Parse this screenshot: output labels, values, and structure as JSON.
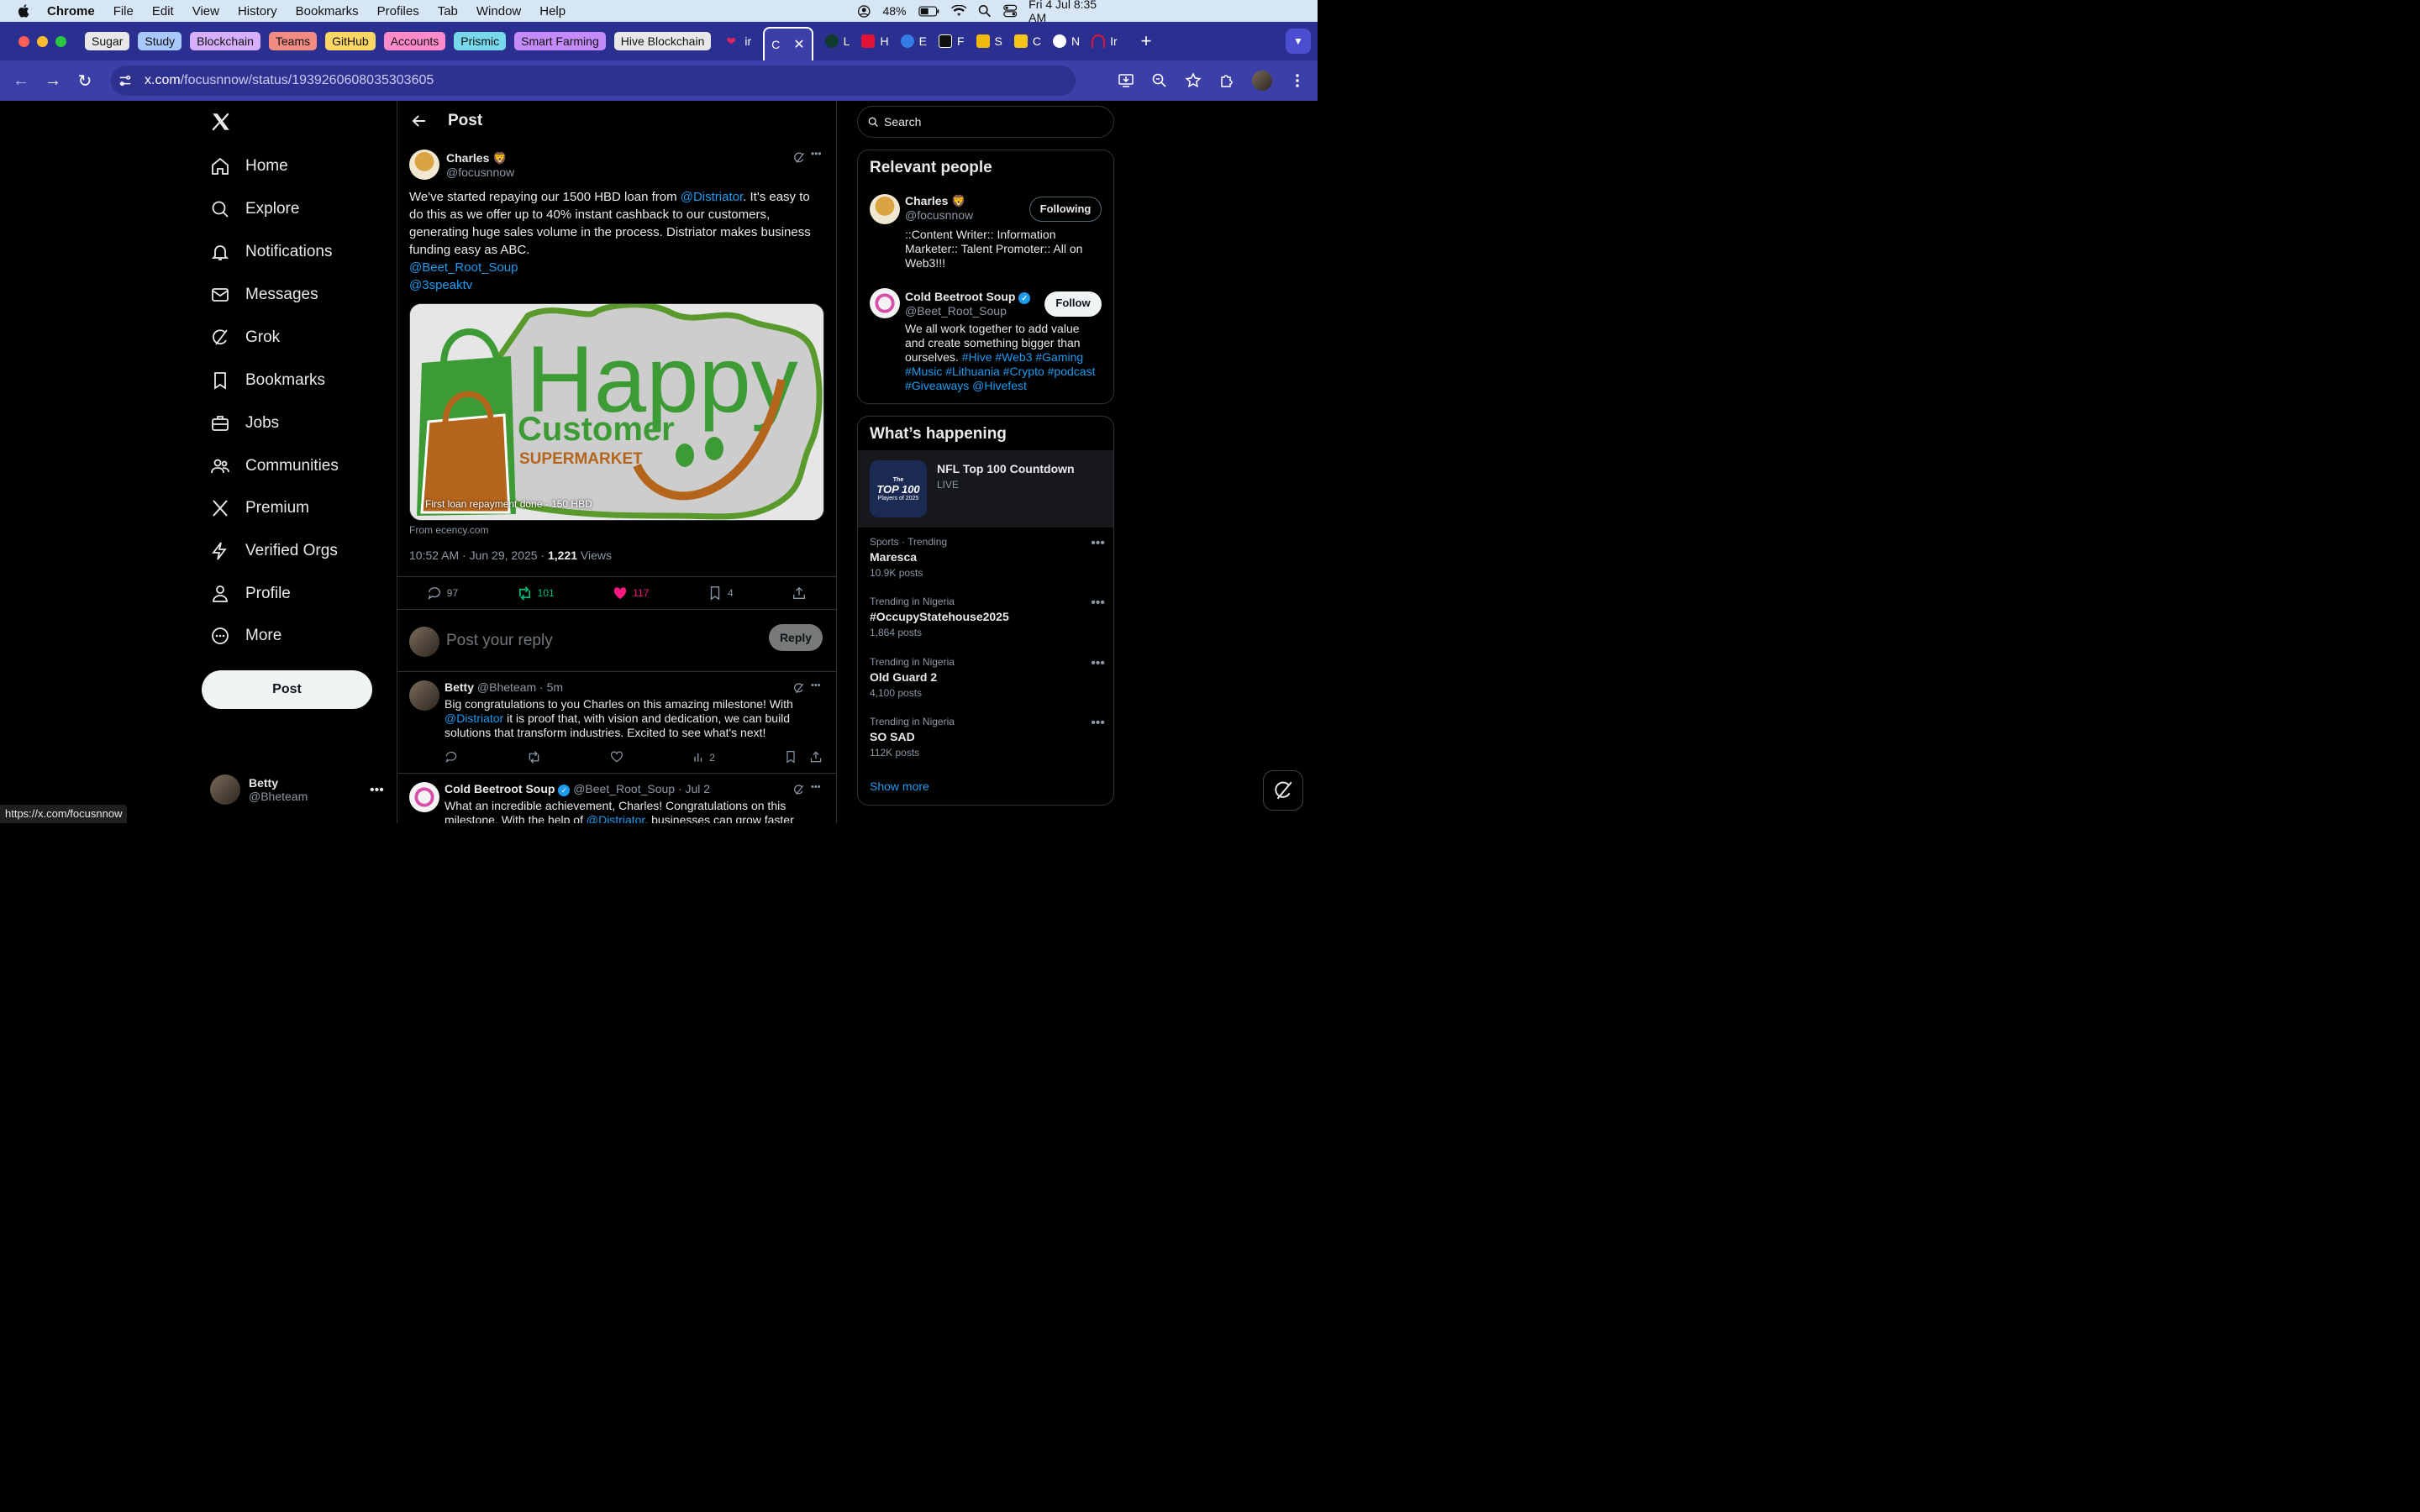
{
  "menubar": {
    "app": "Chrome",
    "items": [
      "File",
      "Edit",
      "View",
      "History",
      "Bookmarks",
      "Profiles",
      "Tab",
      "Window",
      "Help"
    ],
    "battery": "48%",
    "datetime": "Fri 4 Jul  8:35 AM"
  },
  "tabs": {
    "groups": [
      {
        "label": "Sugar",
        "color": "#e8e8e8"
      },
      {
        "label": "Study",
        "color": "#a8c7fa"
      },
      {
        "label": "Blockchain",
        "color": "#d7aefb"
      },
      {
        "label": "Teams",
        "color": "#f28b82"
      },
      {
        "label": "GitHub",
        "color": "#fdd663"
      },
      {
        "label": "Accounts",
        "color": "#ff8bcb"
      },
      {
        "label": "Prismic",
        "color": "#78d9ec"
      },
      {
        "label": "Smart Farming",
        "color": "#c58af9"
      },
      {
        "label": "Hive Blockchain",
        "color": "#e8e8e8"
      }
    ],
    "pinned": [
      {
        "label": "ir",
        "color": "#e0245e"
      },
      {
        "label": "C",
        "color": "#3c3fa8",
        "active": true
      },
      {
        "label": "L",
        "color": "#1db954"
      },
      {
        "label": "H",
        "color": "#e31337"
      },
      {
        "label": "E",
        "color": "#1d9bf0"
      },
      {
        "label": "F",
        "color": "#000000"
      },
      {
        "label": "S",
        "color": "#f0b90b"
      },
      {
        "label": "C",
        "color": "#f5c518"
      },
      {
        "label": "N",
        "color": "#ffffff"
      },
      {
        "label": "Ir",
        "color": "#e31337"
      }
    ]
  },
  "address": {
    "domain": "x.com",
    "path": "/focusnnow/status/1939260608035303605"
  },
  "nav": {
    "items": [
      "Home",
      "Explore",
      "Notifications",
      "Messages",
      "Grok",
      "Bookmarks",
      "Jobs",
      "Communities",
      "Premium",
      "Verified Orgs",
      "Profile",
      "More"
    ],
    "post_button": "Post",
    "account_name": "Betty",
    "account_handle": "@Bheteam"
  },
  "post": {
    "header": "Post",
    "author_name": "Charles 🦁",
    "author_handle": "@focusnnow",
    "text_1": "We've started repaying our 1500 HBD loan from ",
    "mention_1": "@Distriator",
    "text_2": ". It's easy to do this as we offer up to 40% instant cashback to our customers, generating huge sales volume in the process. Distriator makes business funding easy as ABC.",
    "mention_2": "@Beet_Root_Soup",
    "mention_3": "@3speaktv",
    "media_line1": "Happy",
    "media_line2": "Customer",
    "media_line3": "SUPERMARKET",
    "media_caption": "First loan repayment done - 150 HBD",
    "source": "From ecency.com",
    "time": "10:52 AM · Jun 29, 2025 · ",
    "views": "1,221",
    "views_label": " Views",
    "replies": "97",
    "reposts": "101",
    "likes": "117",
    "bookmarks": "4",
    "reply_placeholder": "Post your reply",
    "reply_button": "Reply"
  },
  "comments": [
    {
      "name": "Betty",
      "meta": " @Bheteam · 5m",
      "text_1": "Big congratulations to you Charles on this amazing milestone! With ",
      "mention": "@Distriator",
      "text_2": " it is proof that, with vision and dedication, we can build solutions that transform industries. Excited to see what's next!",
      "views": "2"
    },
    {
      "name": "Cold Beetroot Soup",
      "meta": " @Beet_Root_Soup · Jul 2",
      "text_1": "What an incredible achievement, Charles! Congratulations on this milestone. With the help of ",
      "mention": "@Distriator",
      "text_2": ", businesses can grow faster and"
    }
  ],
  "sidebar": {
    "search_placeholder": "Search",
    "relevant_title": "Relevant people",
    "people": [
      {
        "name": "Charles 🦁",
        "handle": "@focusnnow",
        "bio": "::Content Writer:: Information Marketer:: Talent Promoter:: All on Web3!!!",
        "button": "Following"
      },
      {
        "name": "Cold Beetroot Soup",
        "handle": "@Beet_Root_Soup",
        "bio_1": "We all work together to add value and create something bigger than ourselves. ",
        "bio_tags": "#Hive #Web3 #Gaming #Music #Lithuania #Crypto #podcast #Giveaways @Hivefest",
        "button": "Follow"
      }
    ],
    "happening_title": "What’s happening",
    "featured": {
      "title": "NFL Top 100 Countdown",
      "status": "LIVE",
      "thumb_1": "The",
      "thumb_2": "TOP 100",
      "thumb_3": "Players of 2025"
    },
    "trends": [
      {
        "context": "Sports · Trending",
        "name": "Maresca",
        "count": "10.9K posts"
      },
      {
        "context": "Trending in Nigeria",
        "name": "#OccupyStatehouse2025",
        "count": "1,864 posts"
      },
      {
        "context": "Trending in Nigeria",
        "name": "Old Guard 2",
        "count": "4,100 posts"
      },
      {
        "context": "Trending in Nigeria",
        "name": "SO SAD",
        "count": "112K posts"
      }
    ],
    "show_more": "Show more"
  },
  "status_url": "https://x.com/focusnnow"
}
